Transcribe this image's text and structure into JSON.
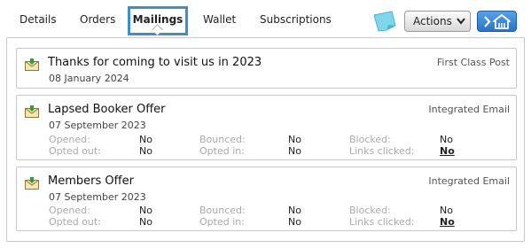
{
  "tabs": [
    {
      "label": "Details"
    },
    {
      "label": "Orders"
    },
    {
      "label": "Mailings",
      "active": true
    },
    {
      "label": "Wallet"
    },
    {
      "label": "Subscriptions"
    }
  ],
  "toolbar": {
    "actions_label": "Actions",
    "note_icon": "sticky-note-icon",
    "home_icon": "arrow-home-icon"
  },
  "colors": {
    "active_tab_border": "#3d8fc6",
    "home_button": "#2b73c4",
    "note_icon": "#7fd6ec"
  },
  "mailings": [
    {
      "title": "Thanks for coming to visit us in 2023",
      "date": "08 January 2024",
      "type": "First Class Post",
      "icon": "mail-download-icon"
    },
    {
      "title": "Lapsed Booker Offer",
      "date": "07 September 2023",
      "type": "Integrated Email",
      "icon": "mail-download-icon",
      "stats": {
        "opened_label": "Opened:",
        "opened": "No",
        "opted_out_label": "Opted out:",
        "opted_out": "No",
        "bounced_label": "Bounced:",
        "bounced": "No",
        "opted_in_label": "Opted in:",
        "opted_in": "No",
        "blocked_label": "Blocked:",
        "blocked": "No",
        "links_clicked_label": "Links clicked:",
        "links_clicked": "No"
      }
    },
    {
      "title": "Members Offer",
      "date": "07 September 2023",
      "type": "Integrated Email",
      "icon": "mail-download-icon",
      "stats": {
        "opened_label": "Opened:",
        "opened": "No",
        "opted_out_label": "Opted out:",
        "opted_out": "No",
        "bounced_label": "Bounced:",
        "bounced": "No",
        "opted_in_label": "Opted in:",
        "opted_in": "No",
        "blocked_label": "Blocked:",
        "blocked": "No",
        "links_clicked_label": "Links clicked:",
        "links_clicked": "No"
      }
    }
  ]
}
